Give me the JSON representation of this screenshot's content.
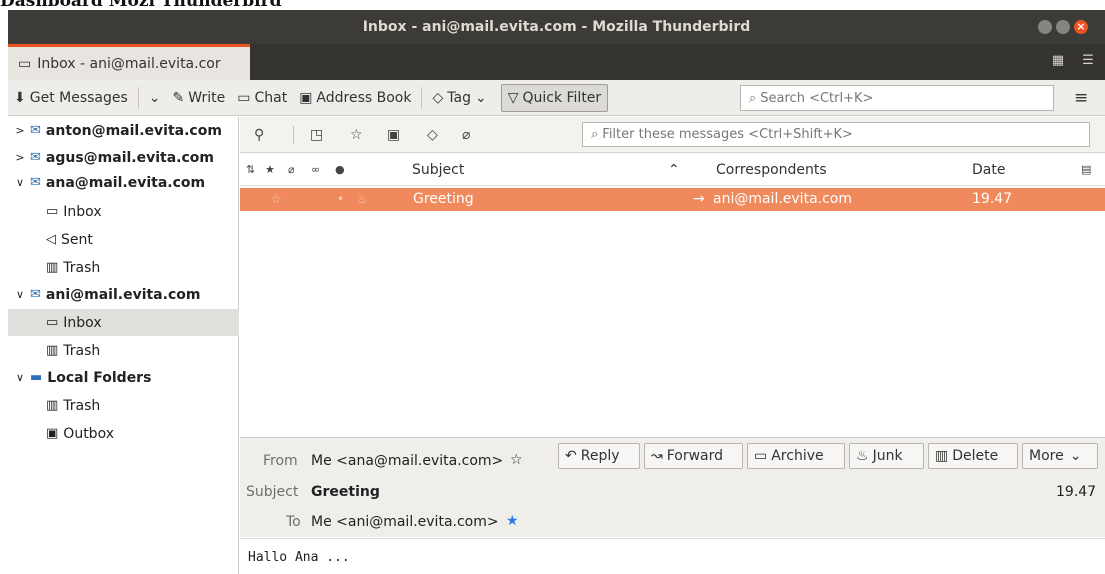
{
  "caption": "Dashboard Mozi Thunderbird",
  "window": {
    "title": "Inbox - ani@mail.evita.com - Mozilla Thunderbird",
    "close_glyph": "×"
  },
  "tab": {
    "label": "Inbox - ani@mail.evita.cor",
    "icon": "inbox-tray-icon"
  },
  "toolbar": {
    "get_messages": "Get Messages",
    "write": "Write",
    "chat": "Chat",
    "address_book": "Address Book",
    "tag": "Tag",
    "quick_filter": "Quick Filter",
    "search_placeholder": "Search <Ctrl+K>"
  },
  "folders": [
    {
      "label": "anton@mail.evita.com",
      "type": "account",
      "expanded": false
    },
    {
      "label": "agus@mail.evita.com",
      "type": "account",
      "expanded": false
    },
    {
      "label": "ana@mail.evita.com",
      "type": "account",
      "expanded": true
    },
    {
      "label": "Inbox",
      "type": "folder"
    },
    {
      "label": "Sent",
      "type": "folder"
    },
    {
      "label": "Trash",
      "type": "folder"
    },
    {
      "label": "ani@mail.evita.com",
      "type": "account",
      "expanded": true
    },
    {
      "label": "Inbox",
      "type": "folder",
      "selected": true
    },
    {
      "label": "Trash",
      "type": "folder"
    },
    {
      "label": "Local Folders",
      "type": "local",
      "expanded": true
    },
    {
      "label": "Trash",
      "type": "folder"
    },
    {
      "label": "Outbox",
      "type": "folder"
    }
  ],
  "filter": {
    "placeholder": "Filter these messages <Ctrl+Shift+K>"
  },
  "columns": {
    "subject": "Subject",
    "correspondents": "Correspondents",
    "date": "Date"
  },
  "messages": [
    {
      "subject": "Greeting",
      "correspondent": "ani@mail.evita.com",
      "date": "19.47",
      "selected": true
    }
  ],
  "header": {
    "from_label": "From",
    "from_value": "Me <ana@mail.evita.com>",
    "subject_label": "Subject",
    "subject_value": "Greeting",
    "date": "19.47",
    "to_label": "To",
    "to_value": "Me <ani@mail.evita.com>",
    "buttons": {
      "reply": "Reply",
      "forward": "Forward",
      "archive": "Archive",
      "junk": "Junk",
      "delete": "Delete",
      "more": "More"
    }
  },
  "body": {
    "text": "Hallo Ana ..."
  },
  "colors": {
    "accent": "#e95420",
    "selected_row": "#f08a5d",
    "titlebar": "#3c3b37"
  }
}
